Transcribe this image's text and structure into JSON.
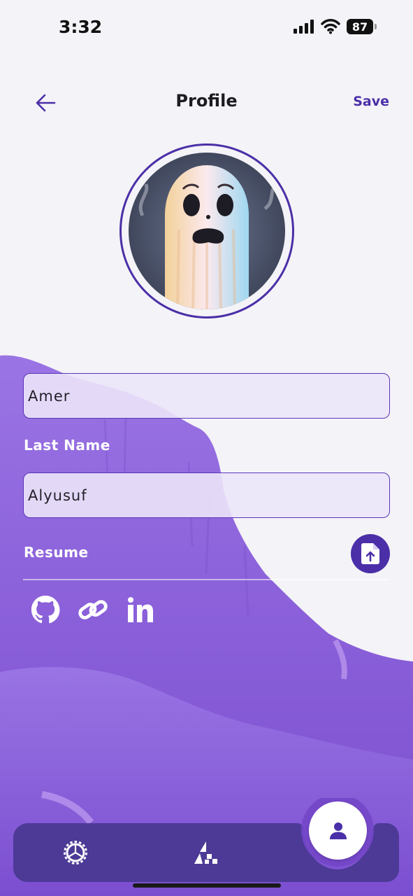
{
  "status_bar": {
    "time": "3:32",
    "battery": "87"
  },
  "header": {
    "title": "Profile",
    "save_label": "Save"
  },
  "form": {
    "first_name_value": "Amer",
    "last_name_label": "Last Name",
    "last_name_value": "Alyusuf",
    "resume_label": "Resume"
  },
  "socials": [
    "github-icon",
    "link-icon",
    "linkedin-icon"
  ],
  "nav": {
    "items": [
      "settings-icon",
      "projects-icon",
      "profile-icon"
    ],
    "active": "profile-icon"
  },
  "colors": {
    "accent": "#4b2fa8",
    "background": "#f4f3f7",
    "purple_bg": "#8f66de",
    "nav_bar": "#4c3a96",
    "field_fill": "#ece6fa"
  }
}
